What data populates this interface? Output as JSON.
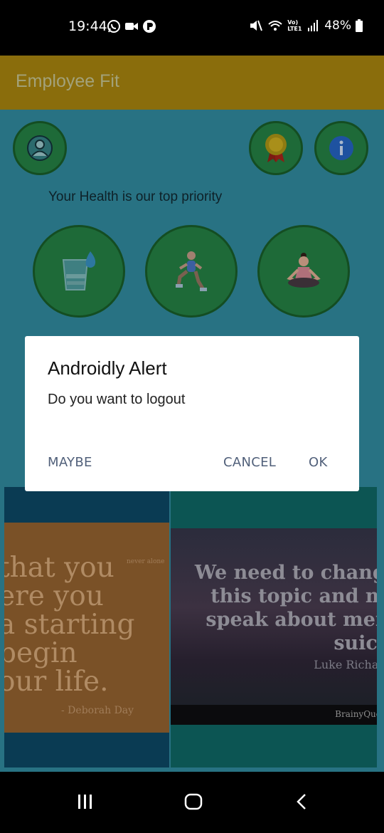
{
  "status_bar": {
    "time": "19:44",
    "battery": "48%",
    "network": "Vo) LTE1"
  },
  "app_bar": {
    "title": "Employee Fit"
  },
  "home": {
    "tagline": "Your Health is our top priority"
  },
  "dialog": {
    "title": "Androidly Alert",
    "message": "Do you want to logout",
    "maybe_label": "MAYBE",
    "cancel_label": "CANCEL",
    "ok_label": "OK"
  },
  "quotes": [
    {
      "lines": "that you\nere you\na starting\nbegin\nour life.",
      "author": "- Deborah Day",
      "brand": "never alone"
    },
    {
      "lines": "We need to change\nthis topic and ma\nspeak about ment\nsuicid",
      "author": "Luke Richar",
      "brand": "BrainyQuo"
    }
  ],
  "colors": {
    "overlay_app_bar": "#8a6d0c",
    "overlay_background": "#287283",
    "overlay_circle": "#1e6a38",
    "dialog_button": "#51607a"
  },
  "icons": [
    "whatsapp-icon",
    "video-icon",
    "app-icon",
    "mute-icon",
    "wifi-icon",
    "signal-icon",
    "battery-icon",
    "profile-icon",
    "award-icon",
    "info-icon",
    "water-icon",
    "exercise-icon",
    "meditation-icon",
    "recent-apps-icon",
    "home-icon",
    "back-icon"
  ]
}
